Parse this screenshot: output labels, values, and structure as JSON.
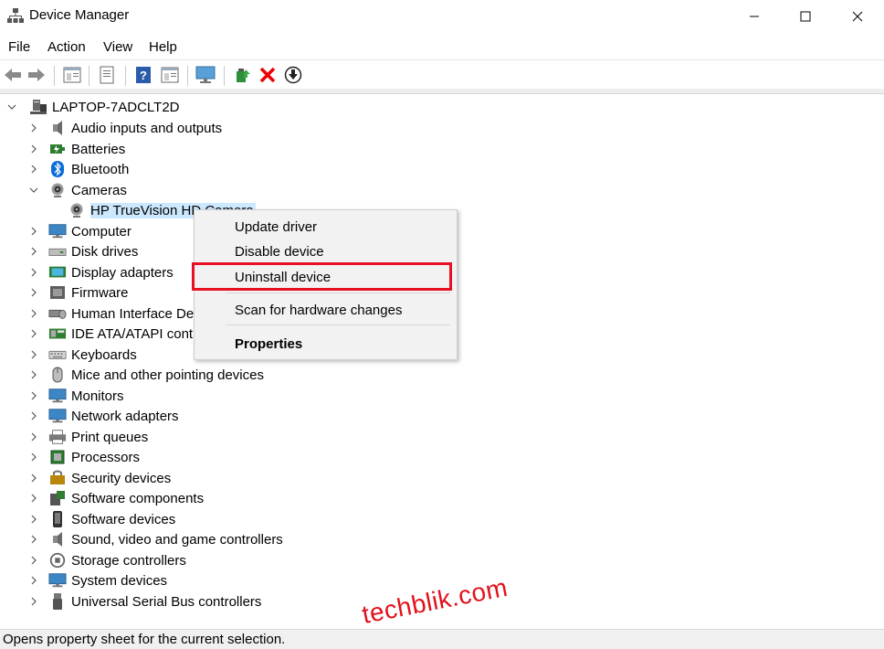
{
  "window": {
    "title": "Device Manager",
    "app_icon": "device-manager-icon"
  },
  "menu": [
    "File",
    "Action",
    "View",
    "Help"
  ],
  "toolbar": [
    "back-arrow-icon",
    "forward-arrow-icon",
    "properties-icon",
    "show-hide-icon",
    "help-icon",
    "view-icon",
    "monitor-icon",
    "update-driver-icon",
    "uninstall-icon",
    "download-icon"
  ],
  "tree": {
    "root": "LAPTOP-7ADCLT2D",
    "categories": [
      {
        "label": "Audio inputs and outputs",
        "icon": "speaker-icon"
      },
      {
        "label": "Batteries",
        "icon": "battery-icon"
      },
      {
        "label": "Bluetooth",
        "icon": "bluetooth-icon"
      },
      {
        "label": "Cameras",
        "icon": "camera-icon",
        "expanded": true,
        "child": "HP TrueVision HD Camera"
      },
      {
        "label": "Computer",
        "icon": "computer-icon"
      },
      {
        "label": "Disk drives",
        "icon": "disk-icon"
      },
      {
        "label": "Display adapters",
        "icon": "display-adapter-icon"
      },
      {
        "label": "Firmware",
        "icon": "firmware-icon"
      },
      {
        "label": "Human Interface Dev",
        "icon": "hid-icon"
      },
      {
        "label": "IDE ATA/ATAPI control",
        "icon": "ide-icon"
      },
      {
        "label": "Keyboards",
        "icon": "keyboard-icon"
      },
      {
        "label": "Mice and other pointing devices",
        "icon": "mouse-icon"
      },
      {
        "label": "Monitors",
        "icon": "monitor-icon"
      },
      {
        "label": "Network adapters",
        "icon": "network-icon"
      },
      {
        "label": "Print queues",
        "icon": "printer-icon"
      },
      {
        "label": "Processors",
        "icon": "processor-icon"
      },
      {
        "label": "Security devices",
        "icon": "security-icon"
      },
      {
        "label": "Software components",
        "icon": "software-component-icon"
      },
      {
        "label": "Software devices",
        "icon": "software-device-icon"
      },
      {
        "label": "Sound, video and game controllers",
        "icon": "speaker-icon"
      },
      {
        "label": "Storage controllers",
        "icon": "storage-icon"
      },
      {
        "label": "System devices",
        "icon": "system-icon"
      },
      {
        "label": "Universal Serial Bus controllers",
        "icon": "usb-icon"
      }
    ]
  },
  "context_menu": {
    "items": [
      "Update driver",
      "Disable device",
      "Uninstall device",
      "Scan for hardware changes",
      "Properties"
    ],
    "highlighted": "Uninstall device",
    "highlight_color": "#e81123"
  },
  "status_bar": {
    "text": "Opens property sheet for the current selection."
  },
  "watermark": "techblik.com",
  "colors": {
    "selection": "#cce8ff",
    "accent_red": "#e81123"
  }
}
